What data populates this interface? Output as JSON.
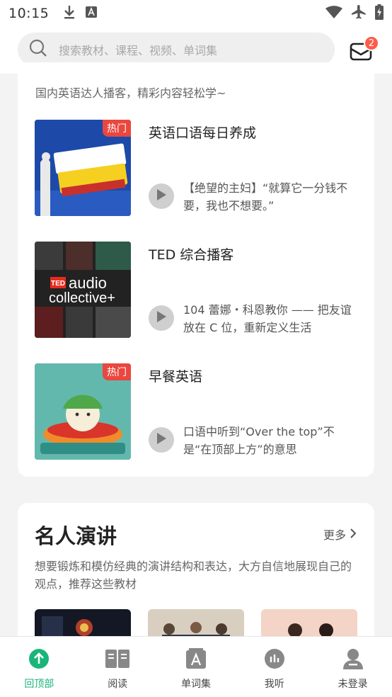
{
  "status_bar": {
    "time": "10:15",
    "left_icons": [
      "download-icon",
      "text-a-icon"
    ],
    "right_icons": [
      "wifi-icon",
      "airplane-icon",
      "battery-charging-icon"
    ]
  },
  "header": {
    "search_placeholder": "搜索教材、课程、视频、单词集",
    "mail_badge": "2"
  },
  "podcasts": {
    "subtitle": "国内英语达人播客，精彩内容轻松学~",
    "items": [
      {
        "title": "英语口语每日养成",
        "hot": "热门",
        "episode": "【绝望的主妇】“就算它一分钱不要，我也不想要。”",
        "cover_color": "#1d4aa8"
      },
      {
        "title": "TED 综合播客",
        "hot": "",
        "episode": "104 蕾娜・科恩教你 —— 把友谊放在 C 位，重新定义生活",
        "cover_color": "#1a1a1a",
        "cover_text_1": "audio",
        "cover_text_2": "collective+",
        "cover_logo": "TED"
      },
      {
        "title": "早餐英语",
        "hot": "热门",
        "episode": "口语中听到“Over the top”不是“在顶部上方”的意思",
        "cover_color": "#63b8ae"
      }
    ]
  },
  "speeches": {
    "title": "名人演讲",
    "more": "更多",
    "description": "想要锻炼和模仿经典的演讲结构和表达，大方自信地展现自己的观点，推荐这些教材"
  },
  "tabs": [
    {
      "label": "回顶部",
      "icon": "arrow-up-circle-icon",
      "active": true
    },
    {
      "label": "阅读",
      "icon": "book-icon",
      "active": false
    },
    {
      "label": "单词集",
      "icon": "word-book-icon",
      "active": false
    },
    {
      "label": "我听",
      "icon": "audio-bars-icon",
      "active": false
    },
    {
      "label": "未登录",
      "icon": "user-icon",
      "active": false
    }
  ],
  "colors": {
    "accent": "#1bb57a",
    "badge": "#ff5a4a",
    "hot_tag": "#e9473f"
  }
}
